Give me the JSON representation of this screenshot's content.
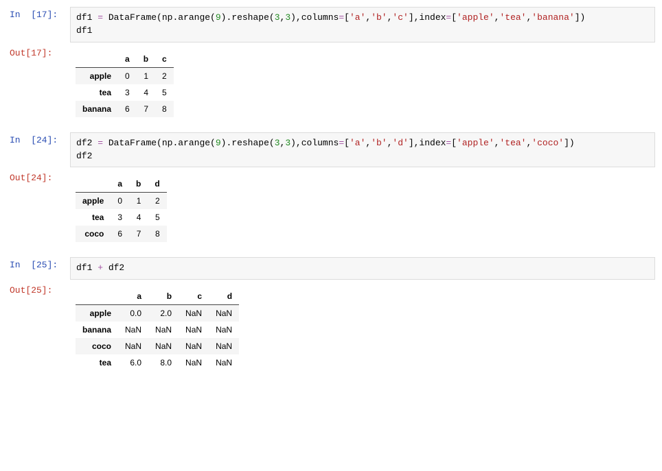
{
  "cells": [
    {
      "in_prompt": "In  [17]:",
      "out_prompt": "Out[17]:",
      "code_tokens": [
        {
          "t": "df1 ",
          "c": "tok-name"
        },
        {
          "t": "=",
          "c": "tok-op"
        },
        {
          "t": " DataFrame(np.arange(",
          "c": "tok-name"
        },
        {
          "t": "9",
          "c": "tok-num"
        },
        {
          "t": ").reshape(",
          "c": "tok-name"
        },
        {
          "t": "3",
          "c": "tok-num"
        },
        {
          "t": ",",
          "c": "tok-name"
        },
        {
          "t": "3",
          "c": "tok-num"
        },
        {
          "t": "),columns",
          "c": "tok-name"
        },
        {
          "t": "=",
          "c": "tok-op"
        },
        {
          "t": "[",
          "c": "tok-name"
        },
        {
          "t": "'a'",
          "c": "tok-str"
        },
        {
          "t": ",",
          "c": "tok-name"
        },
        {
          "t": "'b'",
          "c": "tok-str"
        },
        {
          "t": ",",
          "c": "tok-name"
        },
        {
          "t": "'c'",
          "c": "tok-str"
        },
        {
          "t": "],index",
          "c": "tok-name"
        },
        {
          "t": "=",
          "c": "tok-op"
        },
        {
          "t": "[",
          "c": "tok-name"
        },
        {
          "t": "'apple'",
          "c": "tok-str"
        },
        {
          "t": ",",
          "c": "tok-name"
        },
        {
          "t": "'tea'",
          "c": "tok-str"
        },
        {
          "t": ",",
          "c": "tok-name"
        },
        {
          "t": "'banana'",
          "c": "tok-str"
        },
        {
          "t": "])\n",
          "c": "tok-name"
        },
        {
          "t": "df1",
          "c": "tok-name"
        }
      ],
      "table": {
        "columns": [
          "a",
          "b",
          "c"
        ],
        "index": [
          "apple",
          "tea",
          "banana"
        ],
        "rows": [
          [
            "0",
            "1",
            "2"
          ],
          [
            "3",
            "4",
            "5"
          ],
          [
            "6",
            "7",
            "8"
          ]
        ]
      }
    },
    {
      "in_prompt": "In  [24]:",
      "out_prompt": "Out[24]:",
      "code_tokens": [
        {
          "t": "df2 ",
          "c": "tok-name"
        },
        {
          "t": "=",
          "c": "tok-op"
        },
        {
          "t": " DataFrame(np.arange(",
          "c": "tok-name"
        },
        {
          "t": "9",
          "c": "tok-num"
        },
        {
          "t": ").reshape(",
          "c": "tok-name"
        },
        {
          "t": "3",
          "c": "tok-num"
        },
        {
          "t": ",",
          "c": "tok-name"
        },
        {
          "t": "3",
          "c": "tok-num"
        },
        {
          "t": "),columns",
          "c": "tok-name"
        },
        {
          "t": "=",
          "c": "tok-op"
        },
        {
          "t": "[",
          "c": "tok-name"
        },
        {
          "t": "'a'",
          "c": "tok-str"
        },
        {
          "t": ",",
          "c": "tok-name"
        },
        {
          "t": "'b'",
          "c": "tok-str"
        },
        {
          "t": ",",
          "c": "tok-name"
        },
        {
          "t": "'d'",
          "c": "tok-str"
        },
        {
          "t": "],index",
          "c": "tok-name"
        },
        {
          "t": "=",
          "c": "tok-op"
        },
        {
          "t": "[",
          "c": "tok-name"
        },
        {
          "t": "'apple'",
          "c": "tok-str"
        },
        {
          "t": ",",
          "c": "tok-name"
        },
        {
          "t": "'tea'",
          "c": "tok-str"
        },
        {
          "t": ",",
          "c": "tok-name"
        },
        {
          "t": "'coco'",
          "c": "tok-str"
        },
        {
          "t": "])\n",
          "c": "tok-name"
        },
        {
          "t": "df2",
          "c": "tok-name"
        }
      ],
      "table": {
        "columns": [
          "a",
          "b",
          "d"
        ],
        "index": [
          "apple",
          "tea",
          "coco"
        ],
        "rows": [
          [
            "0",
            "1",
            "2"
          ],
          [
            "3",
            "4",
            "5"
          ],
          [
            "6",
            "7",
            "8"
          ]
        ]
      }
    },
    {
      "in_prompt": "In  [25]:",
      "out_prompt": "Out[25]:",
      "code_tokens": [
        {
          "t": "df1 ",
          "c": "tok-name"
        },
        {
          "t": "+",
          "c": "tok-op"
        },
        {
          "t": " df2",
          "c": "tok-name"
        }
      ],
      "table": {
        "columns": [
          "a",
          "b",
          "c",
          "d"
        ],
        "index": [
          "apple",
          "banana",
          "coco",
          "tea"
        ],
        "rows": [
          [
            "0.0",
            "2.0",
            "NaN",
            "NaN"
          ],
          [
            "NaN",
            "NaN",
            "NaN",
            "NaN"
          ],
          [
            "NaN",
            "NaN",
            "NaN",
            "NaN"
          ],
          [
            "6.0",
            "8.0",
            "NaN",
            "NaN"
          ]
        ]
      }
    }
  ],
  "chart_data": [
    {
      "type": "table",
      "title": "df1",
      "columns": [
        "a",
        "b",
        "c"
      ],
      "index": [
        "apple",
        "tea",
        "banana"
      ],
      "values": [
        [
          0,
          1,
          2
        ],
        [
          3,
          4,
          5
        ],
        [
          6,
          7,
          8
        ]
      ]
    },
    {
      "type": "table",
      "title": "df2",
      "columns": [
        "a",
        "b",
        "d"
      ],
      "index": [
        "apple",
        "tea",
        "coco"
      ],
      "values": [
        [
          0,
          1,
          2
        ],
        [
          3,
          4,
          5
        ],
        [
          6,
          7,
          8
        ]
      ]
    },
    {
      "type": "table",
      "title": "df1 + df2",
      "columns": [
        "a",
        "b",
        "c",
        "d"
      ],
      "index": [
        "apple",
        "banana",
        "coco",
        "tea"
      ],
      "values": [
        [
          0.0,
          2.0,
          null,
          null
        ],
        [
          null,
          null,
          null,
          null
        ],
        [
          null,
          null,
          null,
          null
        ],
        [
          6.0,
          8.0,
          null,
          null
        ]
      ]
    }
  ]
}
